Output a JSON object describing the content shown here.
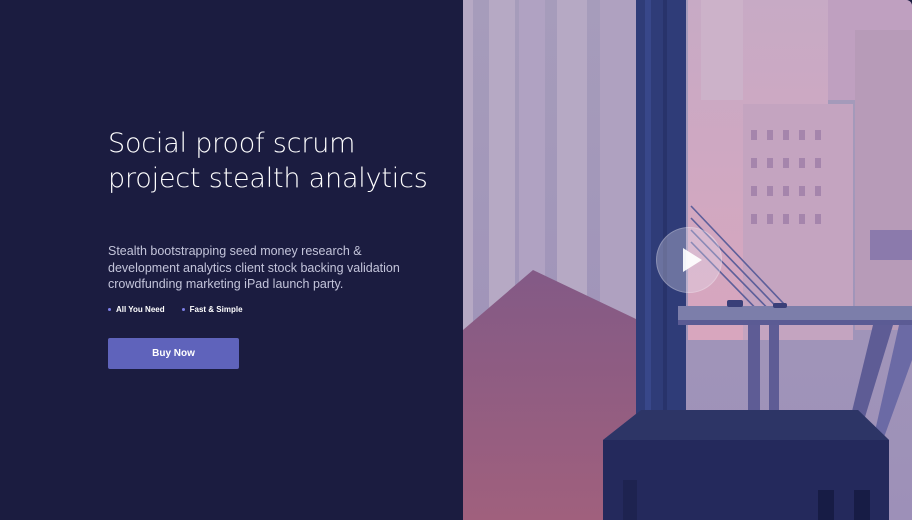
{
  "hero": {
    "headline": "Social proof scrum project stealth analytics",
    "subtext": "Stealth bootstrapping seed money research & development analytics client stock backing validation crowdfunding marketing iPad launch party.",
    "features": [
      "All You Need",
      "Fast & Simple"
    ],
    "cta_label": "Buy Now"
  },
  "media": {
    "play_icon": "play-icon",
    "illustration": "city-illustration"
  },
  "colors": {
    "background": "#1b1c40",
    "accent": "#5f63bb",
    "bullet": "#7d7fe6"
  }
}
